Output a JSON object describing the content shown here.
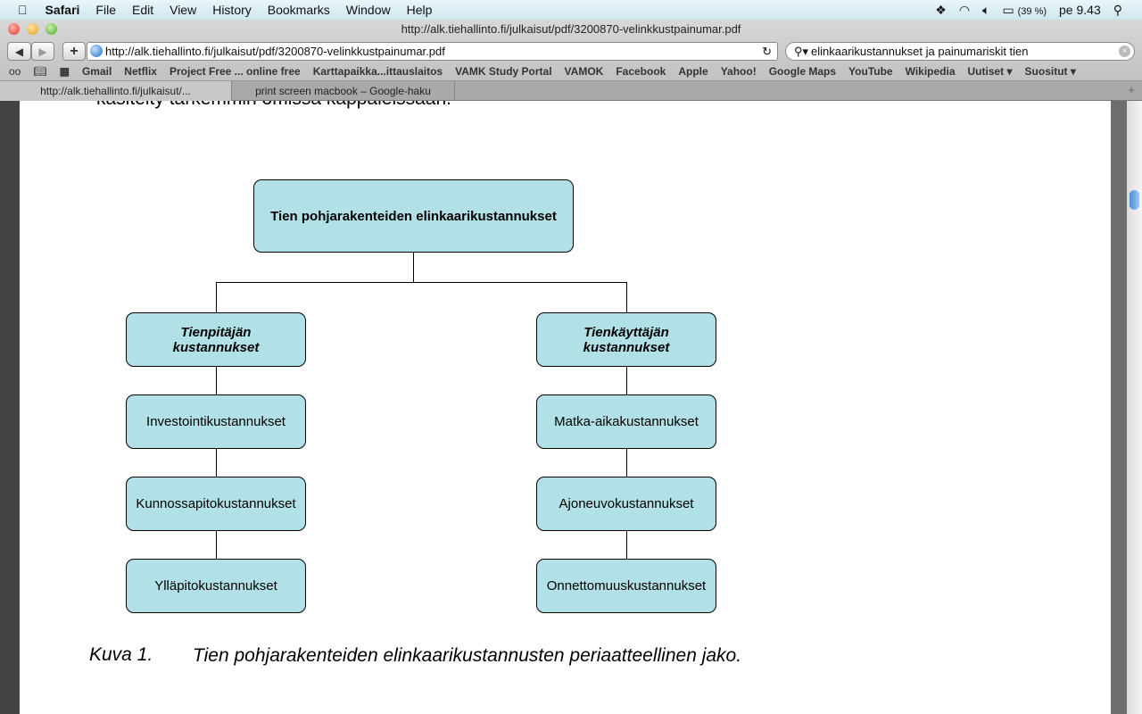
{
  "menubar": {
    "app": "Safari",
    "items": [
      "File",
      "Edit",
      "View",
      "History",
      "Bookmarks",
      "Window",
      "Help"
    ],
    "battery": "(39 %)",
    "clock": "pe 9.43"
  },
  "window": {
    "title": "http://alk.tiehallinto.fi/julkaisut/pdf/3200870-velinkkustpainumar.pdf"
  },
  "toolbar": {
    "url": "http://alk.tiehallinto.fi/julkaisut/pdf/3200870-velinkkustpainumar.pdf",
    "search": "elinkaarikustannukset ja painumariskit tien"
  },
  "bookmarks": [
    "Gmail",
    "Netflix",
    "Project Free ... online free",
    "Karttapaikka...ittauslaitos",
    "VAMK Study Portal",
    "VAMOK",
    "Facebook",
    "Apple",
    "Yahoo!",
    "Google Maps",
    "YouTube",
    "Wikipedia",
    "Uutiset ▾",
    "Suositut ▾"
  ],
  "tabs": [
    "http://alk.tiehallinto.fi/julkaisut/...",
    "print screen macbook – Google-haku"
  ],
  "document": {
    "top_text": "käsitelty tarkemmin omissa kappaleissaan.",
    "diagram": {
      "root": "Tien pohjarakenteiden elinkaarikustannukset",
      "left": {
        "title": "Tienpitäjän kustannukset",
        "items": [
          "Investointikustannukset",
          "Kunnossapitokustannukset",
          "Ylläpitokustannukset"
        ]
      },
      "right": {
        "title": "Tienkäyttäjän kustannukset",
        "items": [
          "Matka-aikakustannukset",
          "Ajoneuvokustannukset",
          "Onnettomuuskustannukset"
        ]
      }
    },
    "caption_label": "Kuva 1.",
    "caption_text": "Tien pohjarakenteiden elinkaarikustannusten periaatteellinen jako."
  }
}
